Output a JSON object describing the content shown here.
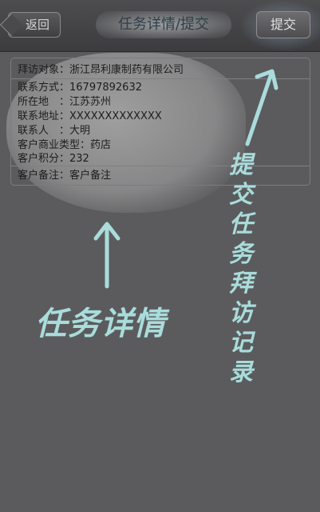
{
  "header": {
    "back_label": "返回",
    "title": "任务详情/提交",
    "submit_label": "提交"
  },
  "detail": {
    "visit_target": "拜访对象：浙江昂利康制药有限公司",
    "contact": "联系方式：16797892632",
    "location": "所在地　：江苏苏州",
    "address": "联系地址：XXXXXXXXXXXXX",
    "contact_person": "联系人　：大明",
    "customer_type": "客户商业类型：药店",
    "points": "客户积分：232",
    "remark": "客户备注：客户备注"
  },
  "annotations": {
    "left_label": "任务详情",
    "right_label_chars": [
      "提",
      "交",
      "任",
      "务",
      "拜",
      "访",
      "记",
      "录"
    ],
    "color": "#a9dcdb"
  }
}
